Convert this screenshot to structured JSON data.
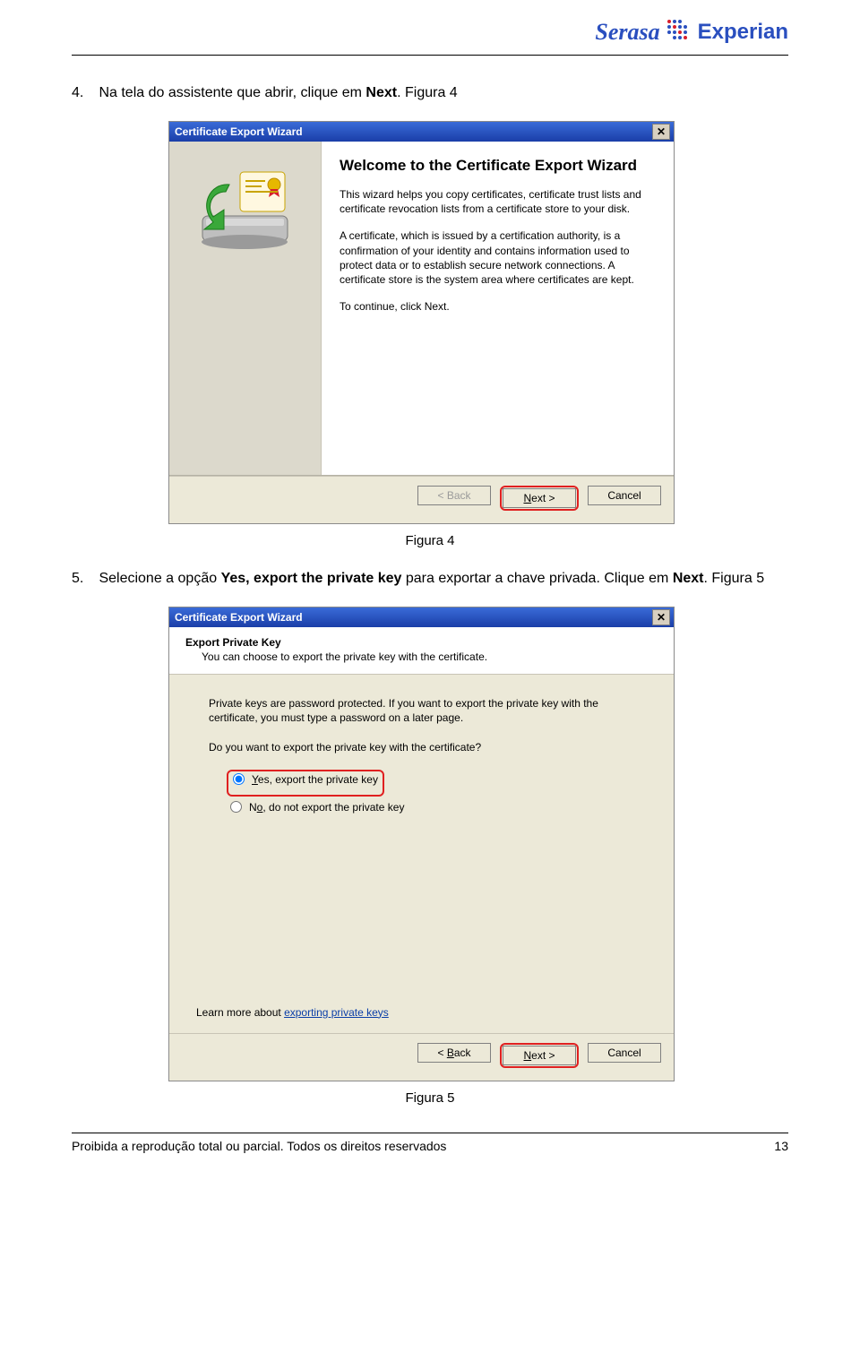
{
  "logo": {
    "serasa": "Serasa",
    "experian": "Experian"
  },
  "step4": {
    "num": "4.",
    "text": "Na tela do assistente que abrir, clique em ",
    "bold": "Next",
    "text2": ". Figura 4"
  },
  "caption4": "Figura 4",
  "step5": {
    "num": "5.",
    "text": "Selecione a opção ",
    "bold": "Yes, export the private key",
    "text2": " para exportar a chave privada. Clique em ",
    "bold2": "Next",
    "text3": ". Figura 5"
  },
  "caption5": "Figura 5",
  "wizard1": {
    "title": "Certificate Export Wizard",
    "heading": "Welcome to the Certificate Export Wizard",
    "p1": "This wizard helps you copy certificates, certificate trust lists and certificate revocation lists from a certificate store to your disk.",
    "p2": "A certificate, which is issued by a certification authority, is a confirmation of your identity and contains information used to protect data or to establish secure network connections. A certificate store is the system area where certificates are kept.",
    "p3": "To continue, click Next.",
    "back": "< Back",
    "next_pre": "N",
    "next_post": "ext >",
    "cancel": "Cancel"
  },
  "wizard2": {
    "title": "Certificate Export Wizard",
    "head_title": "Export Private Key",
    "head_sub": "You can choose to export the private key with the certificate.",
    "p1": "Private keys are password protected. If you want to export the private key with the certificate, you must type a password on a later page.",
    "p2": "Do you want to export the private key with the certificate?",
    "opt_yes_u": "Y",
    "opt_yes_rest": "es, export the private key",
    "opt_no_u": "o",
    "opt_no_pre": "N",
    "opt_no_rest": ", do not export the private key",
    "learn_pre": "Learn more about ",
    "learn_link": "exporting private keys",
    "back_pre": "< ",
    "back_u": "B",
    "back_post": "ack",
    "next_u": "N",
    "next_post": "ext >",
    "cancel": "Cancel"
  },
  "footer": {
    "text": "Proibida a reprodução total ou parcial. Todos os direitos reservados",
    "page": "13"
  }
}
